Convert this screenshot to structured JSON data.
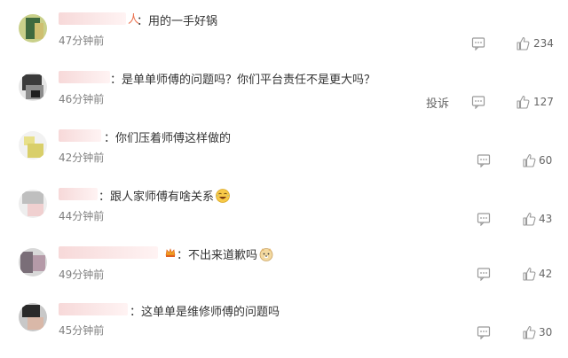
{
  "comments": [
    {
      "name_tail": "人",
      "colon": "：",
      "text": "用的一手好锅",
      "time": "47分钟前",
      "likes": "234",
      "report": "",
      "emoji": ""
    },
    {
      "name_tail": "",
      "colon": "：",
      "text": "是单单师傅的问题吗？你们平台责任不是更大吗？",
      "time": "46分钟前",
      "likes": "127",
      "report": "投诉",
      "emoji": ""
    },
    {
      "name_tail": "",
      "colon": "：",
      "text": "你们压着师傅这样做的",
      "time": "42分钟前",
      "likes": "60",
      "report": "",
      "emoji": ""
    },
    {
      "name_tail": "",
      "colon": "：",
      "text": "跟人家师傅有啥关系",
      "time": "44分钟前",
      "likes": "43",
      "report": "",
      "emoji": "laughing-crying-emoji"
    },
    {
      "name_tail": "",
      "colon": "：",
      "text": "不出来道歉吗",
      "time": "49分钟前",
      "likes": "42",
      "report": "",
      "emoji": "doge-emoji"
    },
    {
      "name_tail": "",
      "colon": "：",
      "text": "这单单是维修师傅的问题吗",
      "time": "45分钟前",
      "likes": "30",
      "report": "",
      "emoji": ""
    }
  ],
  "colors": {
    "name_accent": "#eb7350",
    "time": "#808080",
    "icon": "#999999"
  }
}
